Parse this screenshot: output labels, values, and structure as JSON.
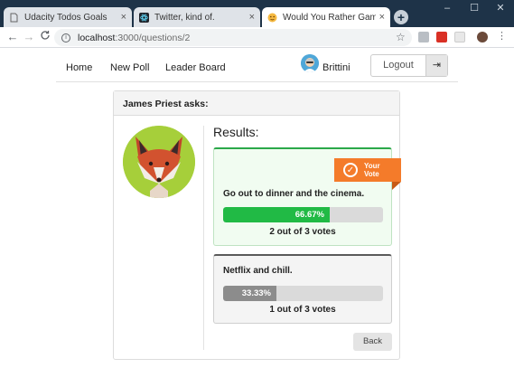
{
  "browser": {
    "tabs": [
      {
        "label": "Udacity Todos Goals",
        "icon": "document-icon",
        "close": "×"
      },
      {
        "label": "Twitter, kind of.",
        "icon": "react-icon",
        "close": "×"
      },
      {
        "label": "Would You Rather Game",
        "icon": "emoji-icon",
        "close": "×"
      }
    ],
    "new_tab": "+",
    "window_controls": {
      "minimize": "–",
      "maximize": "☐",
      "close": "✕"
    },
    "back": "←",
    "forward": "→",
    "reload": "C",
    "info": "i",
    "url_host": "localhost",
    "url_path": ":3000/questions/2",
    "star": "☆"
  },
  "nav": {
    "home": "Home",
    "new_poll": "New Poll",
    "leaderboard": "Leader Board",
    "username": "Brittini",
    "logout": "Logout",
    "logout_icon": "⇥"
  },
  "question": {
    "author_line": "James Priest asks:",
    "results_title": "Results:",
    "your_vote_line1": "Your",
    "your_vote_line2": "Vote",
    "check": "✓",
    "options": [
      {
        "text": "Go out to dinner and the cinema.",
        "percent_label": "66.67%",
        "percent": 66.67,
        "votes_text": "2 out of 3 votes"
      },
      {
        "text": "Netflix and chill.",
        "percent_label": "33.33%",
        "percent": 33.33,
        "votes_text": "1 out of 3 votes"
      }
    ],
    "back": "Back"
  },
  "colors": {
    "voted_bar": "#21ba45",
    "other_bar": "#8c8c8c",
    "badge": "#f47b2a",
    "avatar_bg": "#a6cf3a"
  }
}
